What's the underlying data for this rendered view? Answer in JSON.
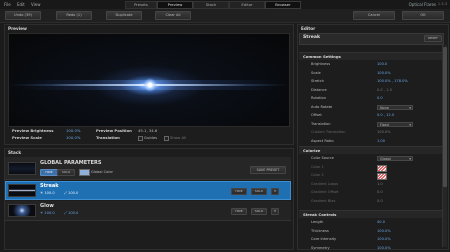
{
  "menu": [
    "File",
    "Edit",
    "View"
  ],
  "tabs": [
    {
      "label": "Presets",
      "active": false
    },
    {
      "label": "Preview",
      "active": true
    },
    {
      "label": "Stack",
      "active": false
    },
    {
      "label": "Editor",
      "active": false
    },
    {
      "label": "Browser",
      "active": true
    }
  ],
  "app_title": "Optical Flares",
  "version": "1.3.3",
  "toolbar": {
    "undo": "Undo (39)",
    "redo": "Redo (1)",
    "duplicate": "Duplicate",
    "clear_all": "Clear All",
    "cancel": "Cancel",
    "ok": "OK"
  },
  "preview": {
    "title": "Preview",
    "brightness_label": "Preview Brightness",
    "brightness_value": "100.0%",
    "scale_label": "Preview Scale",
    "scale_value": "100.0%",
    "position_label": "Preview Position",
    "position_value": "45.1, 34.6",
    "translation_label": "Translation",
    "guides_label": "Guides",
    "show_all_label": "Show All"
  },
  "stack": {
    "title": "Stack",
    "global": {
      "name": "GLOBAL PARAMETERS",
      "hide": "HIDE",
      "solo": "SOLO",
      "global_color": "Global Color",
      "save_preset": "SAVE PRESET"
    },
    "layers": [
      {
        "name": "Streak",
        "brightness": "100.0",
        "scale": "100.0",
        "hide": "HIDE",
        "solo": "SOLO",
        "selected": true
      },
      {
        "name": "Glow",
        "brightness": "100.0",
        "scale": "100.0",
        "hide": "HIDE",
        "solo": "SOLO",
        "selected": false
      }
    ]
  },
  "editor": {
    "title": "Editor",
    "element": "Streak",
    "reset": "RESET",
    "common": {
      "title": "Common Settings",
      "rows": [
        {
          "name": "Brightness",
          "value": "100.0"
        },
        {
          "name": "Scale",
          "value": "100.0%"
        },
        {
          "name": "Stretch",
          "value": "100.0% , 178.0%"
        },
        {
          "name": "Distance",
          "value": "0.0 , 1.0",
          "dim_value": true
        },
        {
          "name": "Rotation",
          "value": "0.0"
        },
        {
          "name": "Auto Rotate",
          "dropdown": "None"
        },
        {
          "name": "Offset",
          "value": "0.0 , 12.0"
        },
        {
          "name": "Translation",
          "dropdown": "Fixed"
        },
        {
          "name": "Custom Translation",
          "value": "100.0%",
          "dim": true
        },
        {
          "name": "Aspect Ratio",
          "value": "1.00"
        }
      ]
    },
    "colorize": {
      "title": "Colorize",
      "rows": [
        {
          "name": "Color Source",
          "dropdown": "Global"
        },
        {
          "name": "Color 1",
          "swatch": true,
          "dim": true
        },
        {
          "name": "Color 2",
          "swatch": true,
          "dim": true
        },
        {
          "name": "Gradient Loops",
          "value": "1.0",
          "dim": true
        },
        {
          "name": "Gradient Offset",
          "value": "0.0",
          "dim": true
        },
        {
          "name": "Gradient Bias",
          "value": "0.0",
          "dim": true
        }
      ]
    },
    "streak_controls": {
      "title": "Streak Controls",
      "rows": [
        {
          "name": "Length",
          "value": "40.0"
        },
        {
          "name": "Thickness",
          "value": "100.0%"
        },
        {
          "name": "Core Intensity",
          "value": "100.0%"
        },
        {
          "name": "Symmetry",
          "value": "100.0%"
        }
      ]
    }
  }
}
